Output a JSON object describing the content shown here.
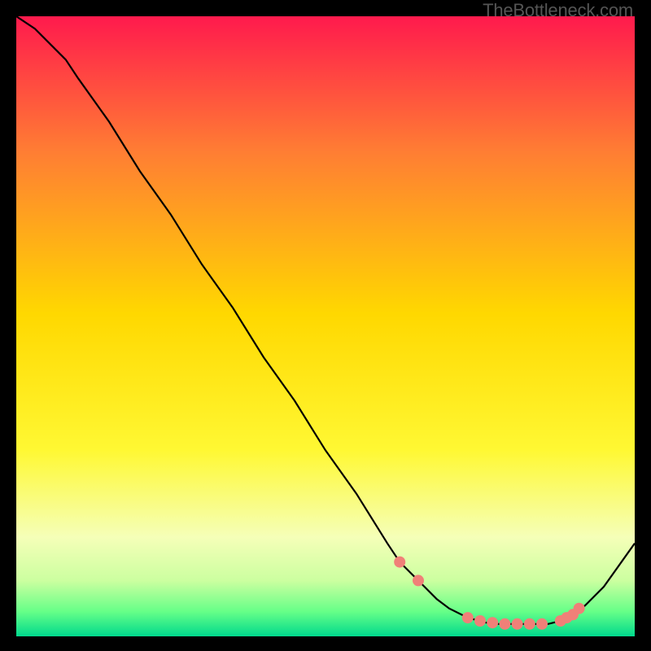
{
  "watermark": "TheBottleneck.com",
  "chart_data": {
    "type": "line",
    "title": "",
    "xlabel": "",
    "ylabel": "",
    "xlim": [
      0,
      100
    ],
    "ylim": [
      0,
      100
    ],
    "series": [
      {
        "name": "curve",
        "x": [
          0,
          3,
          8,
          10,
          15,
          20,
          25,
          30,
          35,
          40,
          45,
          50,
          55,
          60,
          62,
          65,
          68,
          70,
          73,
          76,
          78,
          80,
          82,
          84,
          86,
          88,
          90,
          92,
          95,
          100
        ],
        "y": [
          100,
          98,
          93,
          90,
          83,
          75,
          68,
          60,
          53,
          45,
          38,
          30,
          23,
          15,
          12,
          9,
          6,
          4.5,
          3,
          2.2,
          2,
          2,
          2,
          2,
          2,
          2.5,
          3.5,
          5,
          8,
          15
        ]
      }
    ],
    "markers": {
      "x": [
        62,
        65,
        73,
        75,
        77,
        79,
        81,
        83,
        85,
        88,
        89,
        90,
        91
      ],
      "y": [
        12,
        9,
        3,
        2.5,
        2.2,
        2,
        2,
        2,
        2,
        2.5,
        3,
        3.5,
        4.5
      ]
    },
    "gradient": {
      "stops": [
        {
          "offset": 0,
          "color": "#ff1a4d"
        },
        {
          "offset": 0.25,
          "color": "#ff7e33"
        },
        {
          "offset": 0.5,
          "color": "#ffd800"
        },
        {
          "offset": 0.7,
          "color": "#fff833"
        },
        {
          "offset": 0.85,
          "color": "#f5ffa0"
        },
        {
          "offset": 0.92,
          "color": "#c8ff80"
        },
        {
          "offset": 0.97,
          "color": "#5eff5e"
        },
        {
          "offset": 1.0,
          "color": "#00d98c"
        }
      ]
    }
  }
}
